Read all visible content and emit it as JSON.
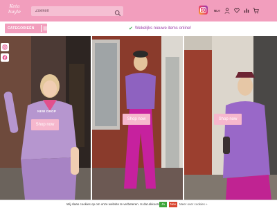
{
  "header": {
    "logo_text": "Keta\nhuyle",
    "search": {
      "placeholder": "Zoeken"
    },
    "lang": "NL"
  },
  "subbar": {
    "categories_label": "CATEGORIEËN",
    "promo_text": "Wekelijks nieuwe items online!"
  },
  "hero": {
    "new_drop": "NEW DROP",
    "panels": [
      {
        "shop_label": "Shop now"
      },
      {
        "shop_label": "Shop now"
      },
      {
        "shop_label": "Shop now"
      }
    ]
  },
  "cookie": {
    "text": "Wij slaan cookies op om onze website te verbeteren. Is dat akkoord?",
    "yes": "Ja",
    "no": "Nee",
    "more": "Meer over cookies »"
  },
  "colors": {
    "brand_pink": "#f29ebd",
    "promo_purple": "#9b3fa8",
    "accept_green": "#3da53a",
    "decline_red": "#d9452f"
  }
}
